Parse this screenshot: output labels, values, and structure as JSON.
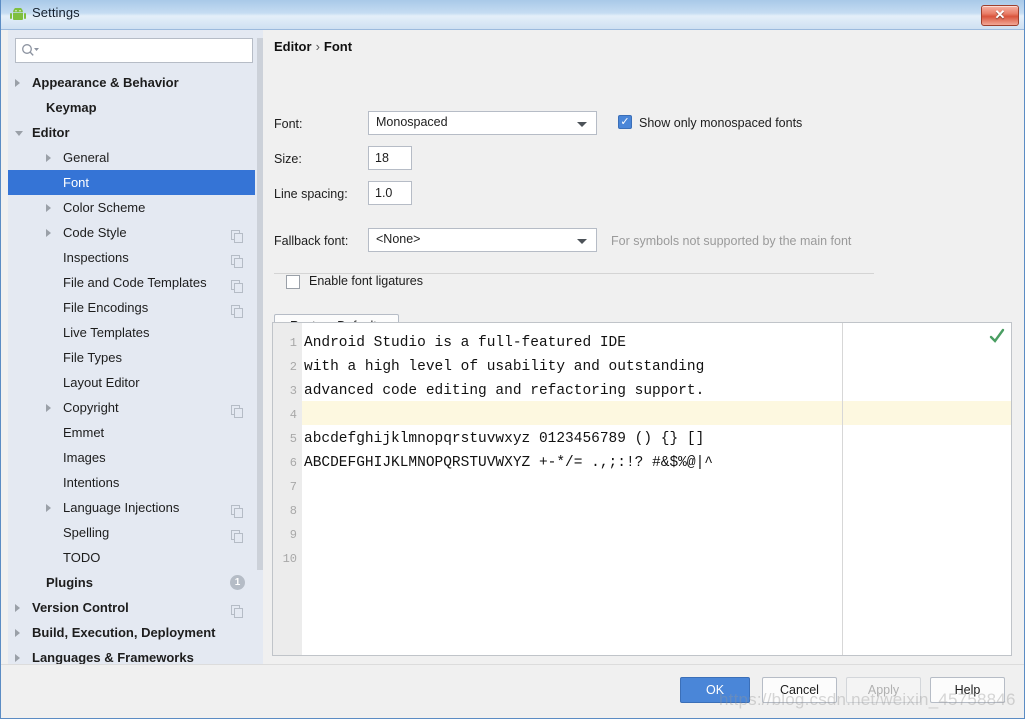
{
  "window": {
    "title": "Settings",
    "icon": "android-robot-icon",
    "close_label": "✕",
    "accent": "#4a86d8",
    "selection_color": "#3574d6"
  },
  "search": {
    "value": "",
    "placeholder": "",
    "icon": "search-icon"
  },
  "sidebar": {
    "items": [
      {
        "label": "Appearance & Behavior",
        "indent": 24,
        "arrow": "right",
        "bold": true,
        "copy": false,
        "badge": ""
      },
      {
        "label": "Keymap",
        "indent": 38,
        "arrow": "",
        "bold": true,
        "copy": false,
        "badge": ""
      },
      {
        "label": "Editor",
        "indent": 24,
        "arrow": "down",
        "bold": true,
        "copy": false,
        "badge": ""
      },
      {
        "label": "General",
        "indent": 55,
        "arrow": "right",
        "bold": false,
        "copy": false,
        "badge": ""
      },
      {
        "label": "Font",
        "indent": 55,
        "arrow": "",
        "bold": false,
        "copy": false,
        "badge": "",
        "selected": true
      },
      {
        "label": "Color Scheme",
        "indent": 55,
        "arrow": "right",
        "bold": false,
        "copy": false,
        "badge": ""
      },
      {
        "label": "Code Style",
        "indent": 55,
        "arrow": "right",
        "bold": false,
        "copy": true,
        "badge": ""
      },
      {
        "label": "Inspections",
        "indent": 55,
        "arrow": "",
        "bold": false,
        "copy": true,
        "badge": ""
      },
      {
        "label": "File and Code Templates",
        "indent": 55,
        "arrow": "",
        "bold": false,
        "copy": true,
        "badge": ""
      },
      {
        "label": "File Encodings",
        "indent": 55,
        "arrow": "",
        "bold": false,
        "copy": true,
        "badge": ""
      },
      {
        "label": "Live Templates",
        "indent": 55,
        "arrow": "",
        "bold": false,
        "copy": false,
        "badge": ""
      },
      {
        "label": "File Types",
        "indent": 55,
        "arrow": "",
        "bold": false,
        "copy": false,
        "badge": ""
      },
      {
        "label": "Layout Editor",
        "indent": 55,
        "arrow": "",
        "bold": false,
        "copy": false,
        "badge": ""
      },
      {
        "label": "Copyright",
        "indent": 55,
        "arrow": "right",
        "bold": false,
        "copy": true,
        "badge": ""
      },
      {
        "label": "Emmet",
        "indent": 55,
        "arrow": "",
        "bold": false,
        "copy": false,
        "badge": ""
      },
      {
        "label": "Images",
        "indent": 55,
        "arrow": "",
        "bold": false,
        "copy": false,
        "badge": ""
      },
      {
        "label": "Intentions",
        "indent": 55,
        "arrow": "",
        "bold": false,
        "copy": false,
        "badge": ""
      },
      {
        "label": "Language Injections",
        "indent": 55,
        "arrow": "right",
        "bold": false,
        "copy": true,
        "badge": ""
      },
      {
        "label": "Spelling",
        "indent": 55,
        "arrow": "",
        "bold": false,
        "copy": true,
        "badge": ""
      },
      {
        "label": "TODO",
        "indent": 55,
        "arrow": "",
        "bold": false,
        "copy": false,
        "badge": ""
      },
      {
        "label": "Plugins",
        "indent": 38,
        "arrow": "",
        "bold": true,
        "copy": false,
        "badge": "1"
      },
      {
        "label": "Version Control",
        "indent": 24,
        "arrow": "right",
        "bold": true,
        "copy": true,
        "badge": ""
      },
      {
        "label": "Build, Execution, Deployment",
        "indent": 24,
        "arrow": "right",
        "bold": true,
        "copy": false,
        "badge": ""
      },
      {
        "label": "Languages & Frameworks",
        "indent": 24,
        "arrow": "right",
        "bold": true,
        "copy": false,
        "badge": ""
      }
    ]
  },
  "main": {
    "breadcrumb": {
      "root": "Editor",
      "separator": "›",
      "leaf": "Font"
    },
    "font_label": "Font:",
    "font_value": "Monospaced",
    "show_monospaced_label": "Show only monospaced fonts",
    "show_monospaced_checked": true,
    "size_label": "Size:",
    "size_value": "18",
    "line_spacing_label": "Line spacing:",
    "line_spacing_value": "1.0",
    "fallback_label": "Fallback font:",
    "fallback_value": "<None>",
    "fallback_hint": "For symbols not supported by the main font",
    "ligatures_label": "Enable font ligatures",
    "ligatures_checked": false,
    "restore_defaults_label": "Restore Defaults"
  },
  "preview": {
    "check_icon": "green-check-icon",
    "highlight_line": 4,
    "lines": [
      {
        "n": "1",
        "text": "Android Studio is a full-featured IDE"
      },
      {
        "n": "2",
        "text": "with a high level of usability and outstanding"
      },
      {
        "n": "3",
        "text": "advanced code editing and refactoring support."
      },
      {
        "n": "4",
        "text": ""
      },
      {
        "n": "5",
        "text": "abcdefghijklmnopqrstuvwxyz 0123456789 () {} []"
      },
      {
        "n": "6",
        "text": "ABCDEFGHIJKLMNOPQRSTUVWXYZ +-*/= .,;:!? #&$%@|^"
      },
      {
        "n": "7",
        "text": ""
      },
      {
        "n": "8",
        "text": ""
      },
      {
        "n": "9",
        "text": ""
      },
      {
        "n": "10",
        "text": ""
      }
    ]
  },
  "footer": {
    "ok": "OK",
    "cancel": "Cancel",
    "apply": "Apply",
    "apply_disabled": true,
    "help": "Help"
  },
  "watermark": "https://blog.csdn.net/weixin_45758846"
}
